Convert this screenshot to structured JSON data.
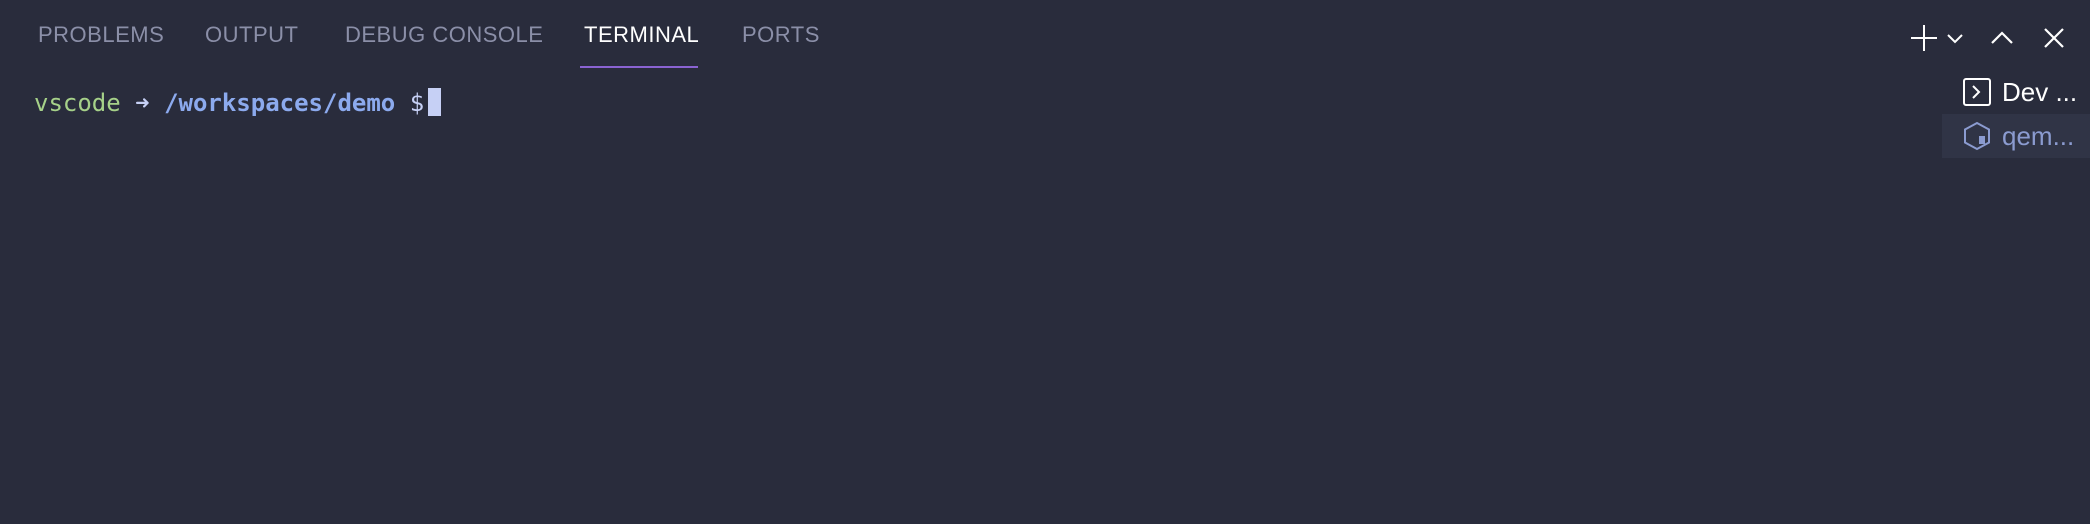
{
  "panel": {
    "tabs": [
      {
        "label": "PROBLEMS"
      },
      {
        "label": "OUTPUT"
      },
      {
        "label": "DEBUG CONSOLE"
      },
      {
        "label": "TERMINAL"
      },
      {
        "label": "PORTS"
      }
    ],
    "active_tab": "TERMINAL"
  },
  "toolbar": {
    "icons": [
      "plus-icon",
      "chevron-down-icon",
      "chevron-up-icon",
      "close-icon"
    ]
  },
  "terminal": {
    "user": "vscode",
    "arrow": "➜",
    "path": "/workspaces/demo",
    "dollar": "$"
  },
  "terminal_list": {
    "items": [
      {
        "label": "Dev ...",
        "icon": "terminal-prompt-icon"
      },
      {
        "label": "qem...",
        "icon": "hexagon-icon"
      }
    ]
  },
  "colors": {
    "background": "#292c3c",
    "accent": "#8a63d2",
    "user": "#a6d189",
    "path": "#8caaee"
  }
}
